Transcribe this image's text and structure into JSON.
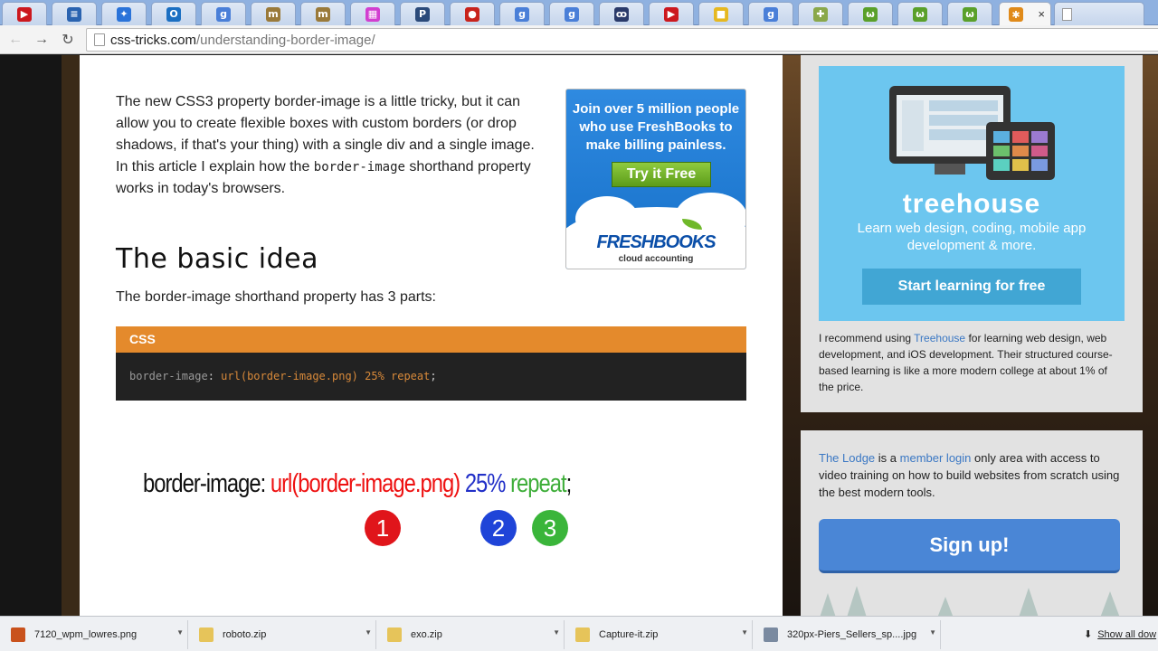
{
  "browser": {
    "tabs": [
      {
        "icon": "youtube-icon",
        "glyph": "▶",
        "color": "#cc181e"
      },
      {
        "icon": "database-icon",
        "glyph": "≡",
        "color": "#2a63b0"
      },
      {
        "icon": "compass-icon",
        "glyph": "✦",
        "color": "#2a73d9"
      },
      {
        "icon": "outlook-icon",
        "glyph": "O",
        "color": "#1b6fc2"
      },
      {
        "icon": "google-icon",
        "glyph": "g",
        "color": "#4a7fd8"
      },
      {
        "icon": "moz-icon",
        "glyph": "m",
        "color": "#9a7a3a"
      },
      {
        "icon": "moz-icon",
        "glyph": "m",
        "color": "#9a7a3a"
      },
      {
        "icon": "colorgrid-icon",
        "glyph": "▦",
        "color": "#d23fd0"
      },
      {
        "icon": "pocket-icon",
        "glyph": "P",
        "color": "#2b4a7a"
      },
      {
        "icon": "apple-icon",
        "glyph": "●",
        "color": "#c8231c"
      },
      {
        "icon": "google-icon",
        "glyph": "g",
        "color": "#4a7fd8"
      },
      {
        "icon": "google-icon",
        "glyph": "g",
        "color": "#4a7fd8"
      },
      {
        "icon": "swirl-icon",
        "glyph": "ꝏ",
        "color": "#2a3a6a"
      },
      {
        "icon": "youtube-icon",
        "glyph": "▶",
        "color": "#cc181e"
      },
      {
        "icon": "square-icon",
        "glyph": "■",
        "color": "#e6b820"
      },
      {
        "icon": "google-icon",
        "glyph": "g",
        "color": "#4a7fd8"
      },
      {
        "icon": "puzzle-icon",
        "glyph": "✚",
        "color": "#8aa84a"
      },
      {
        "icon": "smiley-icon",
        "glyph": "ω",
        "color": "#5aa02a"
      },
      {
        "icon": "smiley-icon",
        "glyph": "ω",
        "color": "#5aa02a"
      },
      {
        "icon": "smiley-icon",
        "glyph": "ω",
        "color": "#5aa02a"
      }
    ],
    "active_tab": {
      "icon": "css-tricks-star-icon",
      "glyph": "✱",
      "color": "#e08a1a",
      "close_glyph": "×"
    },
    "blank_tab_icon": "page-icon",
    "nav": {
      "back": "←",
      "forward": "→",
      "reload": "↻"
    },
    "url": {
      "domain": "css-tricks.com",
      "path": "/understanding-border-image/"
    }
  },
  "article": {
    "intro_pre": "The new CSS3 property border-image is a little tricky, but it can allow you to create flexible boxes with custom borders (or drop shadows, if that's your thing) with a single div and a single image. In this article I explain how the ",
    "intro_code": "border-image",
    "intro_post": " shorthand property works in today's browsers.",
    "heading": "The basic idea",
    "subtext": "The border-image shorthand property has 3 parts:",
    "code_block": {
      "language": "CSS",
      "prop": "border-image",
      "colon": ":",
      "value": "url(border-image.png) 25% repeat",
      "semicolon": ";"
    },
    "diagram": {
      "prop": "border-image:",
      "part1": "url(border-image.png)",
      "part2": "25%",
      "part3": "repeat",
      "end": ";",
      "badge1": "1",
      "badge2": "2",
      "badge3": "3"
    }
  },
  "ad_freshbooks": {
    "text": "Join over 5 million people who use FreshBooks to make billing painless.",
    "button": "Try it Free",
    "logo": "FRESHBOOKS",
    "logo_sub": "cloud accounting"
  },
  "sidebar": {
    "treehouse": {
      "brand": "treehouse",
      "tagline": "Learn web design, coding, mobile app development & more.",
      "button": "Start learning for free",
      "para_pre": "I recommend using ",
      "para_link": "Treehouse",
      "para_post": " for learning web design, web development, and iOS development. Their structured course-based learning is like a more modern college at about 1% of the price."
    },
    "lodge": {
      "link1": "The Lodge",
      "text1": " is a ",
      "link2": "member login",
      "text2": " only area with access to video training on how to build websites from scratch using the best modern tools.",
      "button": "Sign up!"
    }
  },
  "downloads": {
    "items": [
      {
        "name": "7120_wpm_lowres.png",
        "icon": "image-file-icon",
        "color": "#c9521c"
      },
      {
        "name": "roboto.zip",
        "icon": "zip-file-icon",
        "color": "#e6c45a"
      },
      {
        "name": "exo.zip",
        "icon": "zip-file-icon",
        "color": "#e6c45a"
      },
      {
        "name": "Capture-it.zip",
        "icon": "zip-file-icon",
        "color": "#e6c45a"
      },
      {
        "name": "320px-Piers_Sellers_sp....jpg",
        "icon": "image-file-icon",
        "color": "#7a8aa0"
      }
    ],
    "show_all": "Show all dow"
  }
}
